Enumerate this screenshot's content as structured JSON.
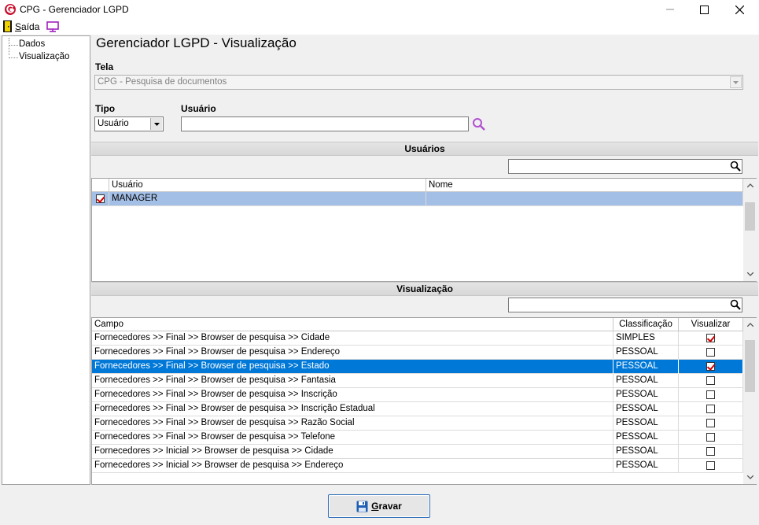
{
  "window": {
    "title": "CPG - Gerenciador LGPD"
  },
  "menu": {
    "exit_label_u": "S",
    "exit_label_rest": "aída"
  },
  "tree": {
    "items": [
      "Dados",
      "Visualização"
    ]
  },
  "page_title": "Gerenciador LGPD - Visualização",
  "tela": {
    "label": "Tela",
    "value": "CPG - Pesquisa de documentos"
  },
  "tipo": {
    "label": "Tipo",
    "value": "Usuário"
  },
  "usuario_field": {
    "label": "Usuário",
    "value": ""
  },
  "usuarios_section": {
    "title": "Usuários",
    "filter_value": "",
    "columns": [
      "Usuário",
      "Nome"
    ],
    "rows": [
      {
        "checked": true,
        "usuario": "MANAGER",
        "nome": ""
      }
    ]
  },
  "visualizacao_section": {
    "title": "Visualização",
    "filter_value": "",
    "columns": [
      "Campo",
      "Classificação",
      "Visualizar"
    ],
    "rows": [
      {
        "campo": "Fornecedores >> Final >> Browser de pesquisa >> Cidade",
        "classificacao": "SIMPLES",
        "visualizar": true
      },
      {
        "campo": "Fornecedores >> Final >> Browser de pesquisa >> Endereço",
        "classificacao": "PESSOAL",
        "visualizar": false
      },
      {
        "campo": "Fornecedores >> Final >> Browser de pesquisa >> Estado",
        "classificacao": "PESSOAL",
        "visualizar": true
      },
      {
        "campo": "Fornecedores >> Final >> Browser de pesquisa >> Fantasia",
        "classificacao": "PESSOAL",
        "visualizar": false
      },
      {
        "campo": "Fornecedores >> Final >> Browser de pesquisa >> Inscrição",
        "classificacao": "PESSOAL",
        "visualizar": false
      },
      {
        "campo": "Fornecedores >> Final >> Browser de pesquisa >> Inscrição Estadual",
        "classificacao": "PESSOAL",
        "visualizar": false
      },
      {
        "campo": "Fornecedores >> Final >> Browser de pesquisa >> Razão Social",
        "classificacao": "PESSOAL",
        "visualizar": false
      },
      {
        "campo": "Fornecedores >> Final >> Browser de pesquisa >> Telefone",
        "classificacao": "PESSOAL",
        "visualizar": false
      },
      {
        "campo": "Fornecedores >> Inicial >> Browser de pesquisa >> Cidade",
        "classificacao": "PESSOAL",
        "visualizar": false
      },
      {
        "campo": "Fornecedores >> Inicial >> Browser de pesquisa >> Endereço",
        "classificacao": "PESSOAL",
        "visualizar": false
      }
    ],
    "selected_row_index": 2
  },
  "save_button": {
    "u": "G",
    "rest": "ravar"
  },
  "colors": {
    "selection_blue": "#0078d7",
    "selection_light": "#a4bfe6",
    "accent_red": "#d10000"
  }
}
